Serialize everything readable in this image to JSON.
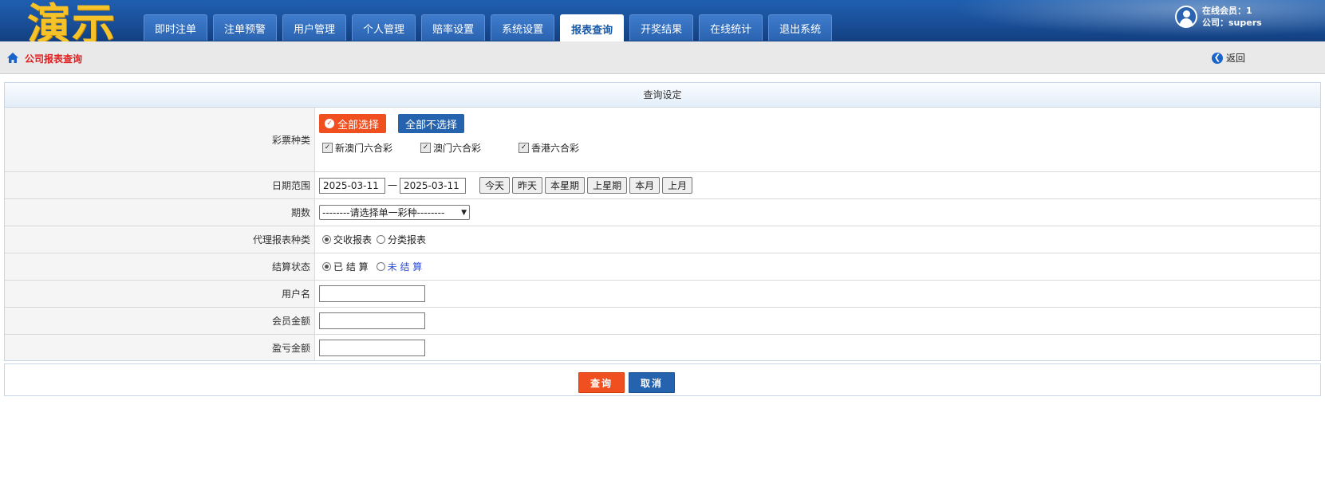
{
  "header": {
    "logo_text": "演示",
    "nav": [
      "即时注单",
      "注单预警",
      "用户管理",
      "个人管理",
      "赔率设置",
      "系统设置",
      "报表查询",
      "开奖结果",
      "在线统计",
      "退出系统"
    ],
    "active_index": 6,
    "online_label": "在线会员：1",
    "company_label": "公司：supers"
  },
  "breadcrumb": {
    "title": "公司报表查询",
    "back_label": "返回"
  },
  "form": {
    "section_title": "查询设定",
    "lottery": {
      "label": "彩票种类",
      "select_all": "全部选择",
      "select_none": "全部不选择",
      "items": [
        "新澳门六合彩",
        "澳门六合彩",
        "香港六合彩"
      ]
    },
    "date": {
      "label": "日期范围",
      "start": "2025-03-11",
      "separator": "一",
      "end": "2025-03-11",
      "quick": [
        "今天",
        "昨天",
        "本星期",
        "上星期",
        "本月",
        "上月"
      ]
    },
    "period": {
      "label": "期数",
      "selected": "--------请选择单一彩种--------"
    },
    "report_type": {
      "label": "代理报表种类",
      "options": [
        "交收报表",
        "分类报表"
      ],
      "selected": 0
    },
    "settle": {
      "label": "结算状态",
      "options": [
        "已 结 算",
        "未 结 算"
      ],
      "selected": 0
    },
    "username": {
      "label": "用户名",
      "value": ""
    },
    "member_amount": {
      "label": "会员金额",
      "value": ""
    },
    "profit_amount": {
      "label": "盈亏金额",
      "value": ""
    }
  },
  "actions": {
    "query": "查询",
    "cancel": "取消"
  },
  "colors": {
    "header": "#1a4f98",
    "accent_red": "#f05020",
    "accent_blue": "#2563ae",
    "logo": "#f5c22a"
  }
}
